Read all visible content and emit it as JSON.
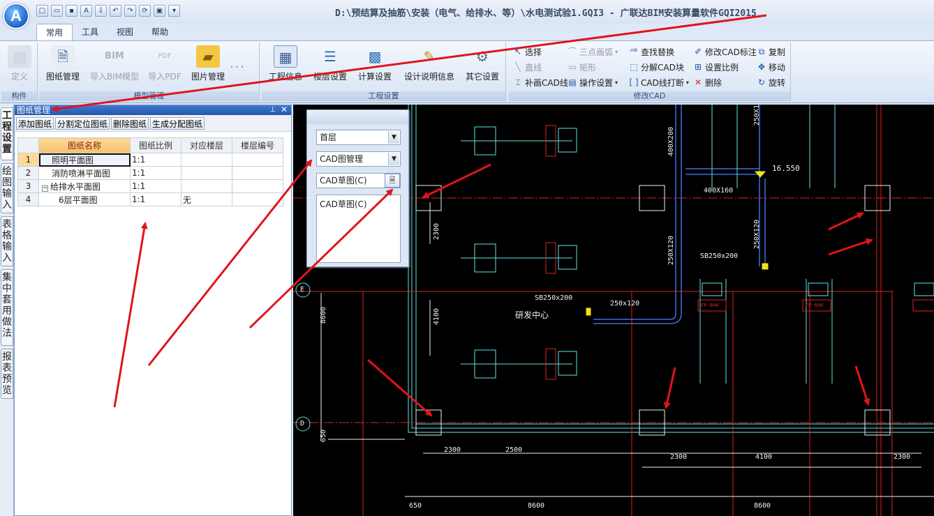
{
  "window": {
    "title": "D:\\预结算及抽筋\\安装（电气、给排水、等）\\水电测试验1.GQI3 - 广联达BIM安装算量软件GQI2015",
    "app_orb": "A"
  },
  "ribbon_tabs": [
    "常用",
    "工具",
    "视图",
    "帮助"
  ],
  "ribbon": {
    "group_component": {
      "label": "构件",
      "define": "定义"
    },
    "group_model": {
      "label": "模型管理",
      "drawing_mgmt": "图纸管理",
      "import_bim": "导入BIM模型",
      "import_pdf": "导入PDF",
      "image_mgmt": "图片管理",
      "more": "· · ·"
    },
    "group_project": {
      "label": "工程设置",
      "project_info": "工程信息",
      "floor_settings": "楼层设置",
      "calc_settings": "计算设置",
      "design_info": "设计说明信息",
      "other_settings": "其它设置"
    },
    "group_modify_cad": {
      "label": "修改CAD",
      "select": "选择",
      "three_point_arc": "三点画弧",
      "find_replace": "查找替换",
      "modify_cad_label": "修改CAD标注",
      "copy": "复制",
      "line": "直线",
      "rect": "矩形",
      "explode_cad_block": "分解CAD块",
      "set_scale": "设置比例",
      "move": "移动",
      "draw_cad_line": "补画CAD线",
      "op_settings": "操作设置",
      "cad_break": "CAD线打断",
      "delete": "删除",
      "rotate": "旋转"
    }
  },
  "vertical_tabs": [
    "工程设置",
    "绘图输入",
    "表格输入",
    "集中套用做法",
    "报表预览"
  ],
  "drawing_panel": {
    "title": "图纸管理",
    "toolbar": [
      "添加图纸",
      "分割定位图纸",
      "删除图纸",
      "生成分配图纸"
    ],
    "columns": [
      "图纸名称",
      "图纸比例",
      "对应楼层",
      "楼层编号"
    ],
    "rows": [
      {
        "no": "1",
        "name": "照明平面图",
        "scale": "1:1",
        "floor": "",
        "floor_no": ""
      },
      {
        "no": "2",
        "name": "消防喷淋平面图",
        "scale": "1:1",
        "floor": "",
        "floor_no": ""
      },
      {
        "no": "3",
        "name": "给排水平面图",
        "scale": "1:1",
        "floor": "",
        "floor_no": ""
      },
      {
        "no": "4",
        "name": "6层平面图",
        "scale": "1:1",
        "floor": "无",
        "floor_no": ""
      }
    ],
    "tree_toggle": "−"
  },
  "cad_panel": {
    "floor_select": "首层",
    "cad_mgmt_select": "CAD图管理",
    "sketch_value": "CAD草图(C)",
    "list_items": [
      "CAD草图(C)"
    ]
  },
  "cad_canvas": {
    "labels": {
      "elev": "16.550",
      "duct_400x160": "400X160",
      "duct_400x200": "400X200",
      "duct_250x1": "250X1",
      "duct_250x120_a": "250X120",
      "duct_250x120_b": "250X120",
      "duct_250x120_c": "250x120",
      "sb_a": "SB250x200",
      "sb_b": "SB250x200",
      "room": "研发中心",
      "axis_e": "E",
      "axis_d": "D",
      "dim_2300_v": "2300",
      "dim_4100_v": "4100",
      "dim_8600_v": "8600",
      "dim_650_v": "650",
      "dim_2300_a": "2300",
      "dim_2500": "2500",
      "dim_2300_b": "2300",
      "dim_4100_h": "4100",
      "dim_2300_c": "2300",
      "dim_650_h": "650",
      "dim_8600_a": "8600",
      "dim_8600_b": "8600",
      "unit_tag": "FP-60H"
    }
  },
  "colors": {
    "canvas_bg": "#000000",
    "annotation_arrow": "#e0141b",
    "panel_title": "#2557a8",
    "cad_cyan": "#5fe6e6",
    "cad_red": "#e02020"
  }
}
